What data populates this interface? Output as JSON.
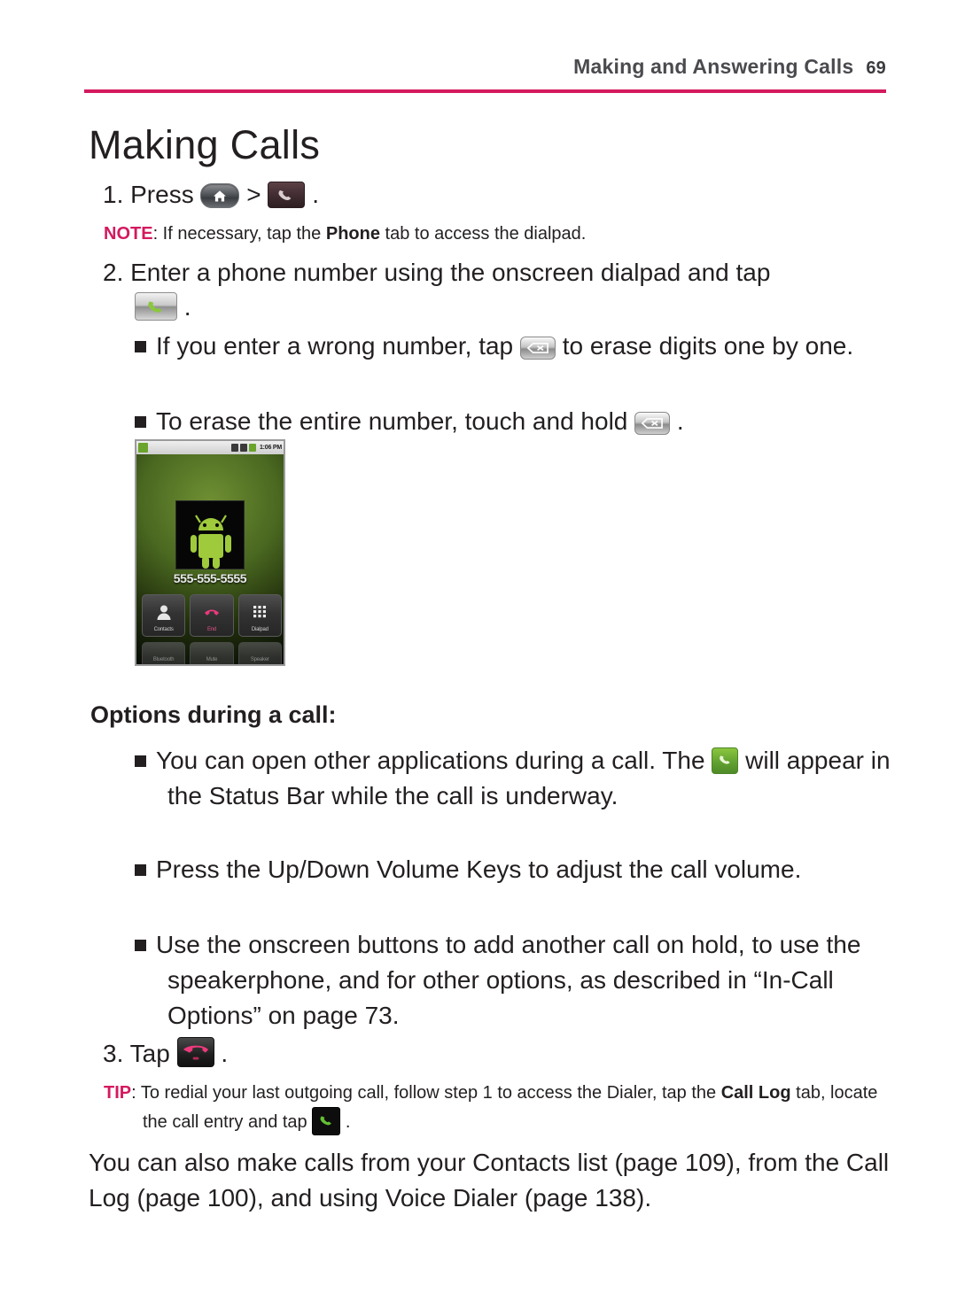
{
  "header": {
    "running_title": "Making and Answering Calls",
    "page_number": "69"
  },
  "title": "Making Calls",
  "steps": {
    "step1_prefix": "1. Press",
    "step1_separator": ">",
    "step1_suffix": ".",
    "note_label": "NOTE",
    "note_text_1": ": If necessary, tap the ",
    "note_bold": "Phone",
    "note_text_2": " tab to access the dialpad.",
    "step2_text": "2. Enter a phone number using the onscreen dialpad and tap",
    "step2_suffix": ".",
    "bullet1_part1": "If you enter a wrong number, tap",
    "bullet1_part2": "to erase digits one by one.",
    "bullet2_part1": "To erase the entire number, touch and hold",
    "bullet2_part2": ".",
    "step3_prefix": "3. Tap",
    "step3_suffix": "."
  },
  "options_heading": "Options during a call:",
  "options_bullets": {
    "b1_part1": "You can open other applications during a call. The",
    "b1_part2": "will appear in the Status Bar while the call is underway.",
    "b2": "Press the Up/Down Volume Keys to adjust the call volume.",
    "b3": "Use the onscreen buttons to add another call on hold, to use the speakerphone, and for other options, as described in “In-Call Options” on page 73."
  },
  "tip": {
    "label": "TIP",
    "text_1": ": To redial your last outgoing call, follow step 1 to access the Dialer, tap the ",
    "bold_1": "Call Log",
    "text_2": " tab, locate the call entry and tap",
    "text_3": "."
  },
  "closing": "You can also make calls from your Contacts list (page 109), from the Call Log (page 100), and using Voice Dialer (page 138).",
  "phone_figure": {
    "status_time": "1:06 PM",
    "phone_number": "555-555-5555",
    "buttons_row1": [
      "Contacts",
      "End",
      "Dialpad"
    ],
    "buttons_row2": [
      "Bluetooth",
      "Mute",
      "Speaker"
    ]
  },
  "icons": {
    "home_key": "home-key-icon",
    "phone_tab": "phone-app-icon",
    "call_button": "call-button-icon",
    "backspace_key": "backspace-key-icon",
    "status_call": "status-bar-call-icon",
    "end_call": "end-call-button-icon",
    "call_log_call": "call-log-call-icon"
  },
  "colors": {
    "accent_pink": "#d4195e",
    "text": "#231f20",
    "header_gray": "#4a4a4f",
    "green_call": "#8cc63f",
    "red_end": "#e8336d"
  }
}
